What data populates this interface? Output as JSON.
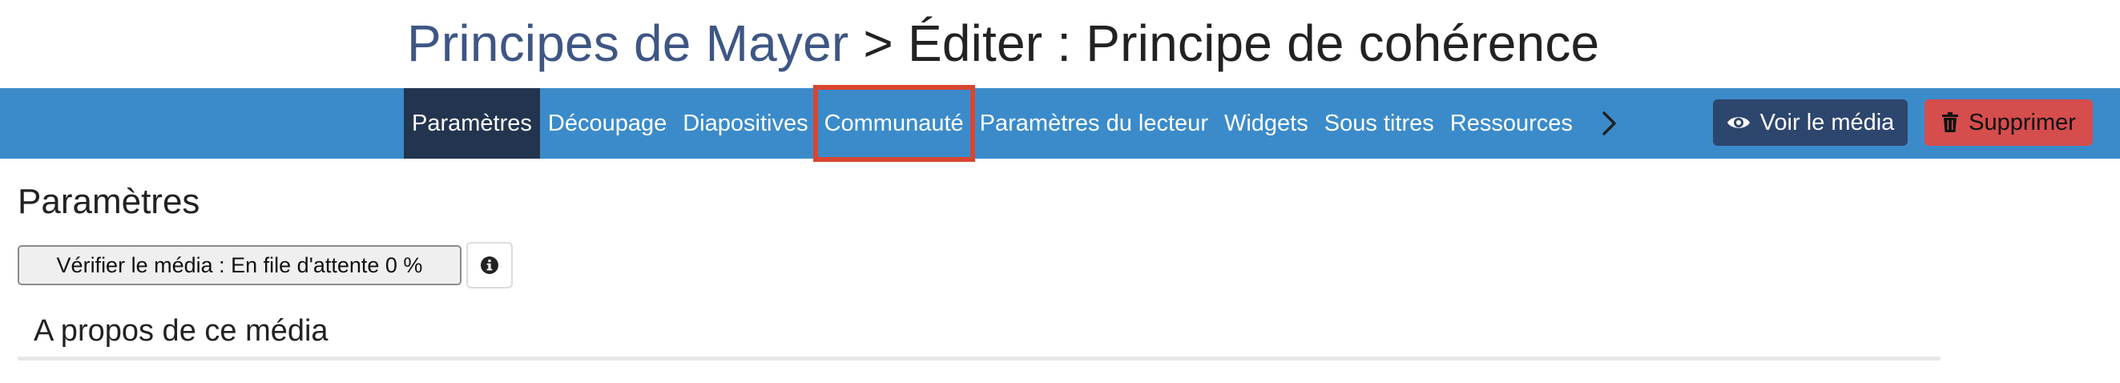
{
  "breadcrumb": {
    "parent": "Principes de Mayer",
    "separator": " > ",
    "current": "Éditer : Principe de cohérence"
  },
  "nav": {
    "tabs": [
      {
        "label": "Paramètres",
        "active": true
      },
      {
        "label": "Découpage",
        "active": false
      },
      {
        "label": "Diapositives",
        "active": false
      },
      {
        "label": "Communauté",
        "active": false,
        "highlighted": true
      },
      {
        "label": "Paramètres du lecteur",
        "active": false
      },
      {
        "label": "Widgets",
        "active": false
      },
      {
        "label": "Sous titres",
        "active": false
      },
      {
        "label": "Ressources",
        "active": false
      }
    ],
    "more_icon": "chevron-right-icon",
    "view_button": {
      "label": "Voir le média",
      "icon": "eye-icon"
    },
    "delete_button": {
      "label": "Supprimer",
      "icon": "trash-icon"
    }
  },
  "main": {
    "section_title": "Paramètres",
    "verify_button": "Vérifier le média : En file d'attente 0 %",
    "info_icon": "info-circle-icon",
    "about_title": "A propos de ce média"
  },
  "colors": {
    "navbar": "#3b8bca",
    "active_tab": "#23344f",
    "highlight_outline": "#d94530",
    "view_button": "#2d466e",
    "delete_button": "#d54d4d",
    "breadcrumb_link": "#3e5684"
  }
}
